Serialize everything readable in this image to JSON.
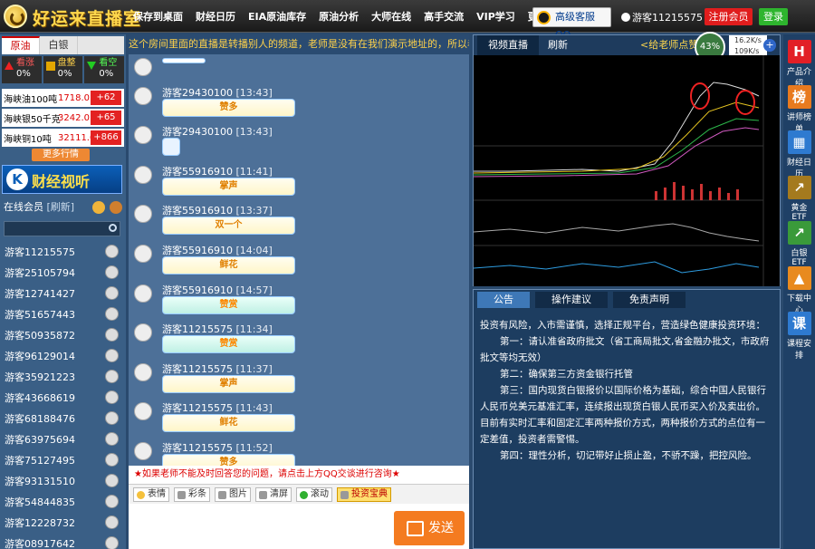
{
  "header": {
    "brand": "好运来直播室",
    "nav": [
      "保存到桌面",
      "财经日历",
      "EIA原油库存",
      "原油分析",
      "大师在线",
      "高手交流",
      "VIP学习",
      "更多"
    ],
    "qq_service": "高级客服QQ",
    "username": "游客11215575",
    "register": "注册会员",
    "login": "登录"
  },
  "left": {
    "tabs": [
      "原油",
      "白银"
    ],
    "stats": [
      {
        "label": "看涨",
        "value": "0%"
      },
      {
        "label": "盘整",
        "value": "0%"
      },
      {
        "label": "看空",
        "value": "0%"
      }
    ],
    "quotes": [
      {
        "name": "海峡油100吨",
        "price": "1718.0",
        "change": "+62"
      },
      {
        "name": "海峡银50千克",
        "price": "3242.0",
        "change": "+65"
      },
      {
        "name": "海峡铜10吨",
        "price": "32111.0",
        "change": "+866"
      }
    ],
    "more_quotes": "更多行情",
    "banner": "财经视听",
    "banner_k": "K",
    "online_title": "在线会员",
    "refresh": "[刷新]",
    "members": [
      "游客11215575",
      "游客25105794",
      "游客12741427",
      "游客51657443",
      "游客50935872",
      "游客96129014",
      "游客35921223",
      "游客43668619",
      "游客68188476",
      "游客63975694",
      "游客75127495",
      "游客93131510",
      "游客54844835",
      "游客12228732",
      "游客08917642"
    ]
  },
  "chat": {
    "marquee": "这个房间里面的直播是转播别人的频道，老师是没有在我们演示地址的，所以老师是看",
    "messages": [
      {
        "user": "",
        "time": "",
        "content": "",
        "type": "text"
      },
      {
        "user": "游客29430100",
        "time": "[13:43]",
        "content": "赞多",
        "type": "gif1"
      },
      {
        "user": "游客29430100",
        "time": "[13:43]",
        "content": "",
        "type": "icon"
      },
      {
        "user": "游客55916910",
        "time": "[11:41]",
        "content": "掌声",
        "type": "gif1"
      },
      {
        "user": "游客55916910",
        "time": "[13:37]",
        "content": "双一个",
        "type": "gif1"
      },
      {
        "user": "游客55916910",
        "time": "[14:04]",
        "content": "鲜花",
        "type": "gif1"
      },
      {
        "user": "游客55916910",
        "time": "[14:57]",
        "content": "赞赏",
        "type": "gif2"
      },
      {
        "user": "游客11215575",
        "time": "[11:34]",
        "content": "赞赏",
        "type": "gif2"
      },
      {
        "user": "游客11215575",
        "time": "[11:37]",
        "content": "掌声",
        "type": "gif1"
      },
      {
        "user": "游客11215575",
        "time": "[11:43]",
        "content": "鲜花",
        "type": "gif1"
      },
      {
        "user": "游客11215575",
        "time": "[11:52]",
        "content": "赞多",
        "type": "gif1"
      }
    ],
    "tip": "★如果老师不能及时回答您的问题，请点击上方QQ交谈进行咨询★",
    "tools": [
      "表情",
      "彩条",
      "图片",
      "清屏",
      "滚动",
      "投资宝典"
    ],
    "send": "发送"
  },
  "video": {
    "tabs": [
      "视频直播",
      "刷新"
    ],
    "gold_link": "<给老师点赞>",
    "buffer": "43%",
    "net_up": "16.2K/s",
    "net_down": "109K/s",
    "plus": "+"
  },
  "notice": {
    "tabs": [
      "公告",
      "操作建议",
      "免责声明"
    ],
    "intro": "投资有风险，入市需谨慎，选择正规平台，营造绿色健康投资环境：",
    "items": [
      "第一：请认准省政府批文（省工商局批文,省金融办批文，市政府批文等均无效）",
      "第二：确保第三方资金银行托管",
      "第三：国内现货白银报价以国际价格为基础，综合中国人民银行人民币兑美元基准汇率，连续报出现货白银人民币买入价及卖出价。目前有实时汇率和固定汇率两种报价方式，两种报价方式的点位有一定差值，投资者需警惕。",
      "第四：理性分析，切记带好止损止盈，不骄不躁，把控风险。"
    ]
  },
  "rside": [
    {
      "label": "产品介绍",
      "icon": "H",
      "color": "#e21f26"
    },
    {
      "label": "讲师榜单",
      "icon": "榜",
      "color": "#e87a1f"
    },
    {
      "label": "财经日历",
      "icon": "▦",
      "color": "#2e7ad0"
    },
    {
      "label": "黄金ETF",
      "icon": "↗",
      "color": "#a47a1e"
    },
    {
      "label": "白银ETF",
      "icon": "↗",
      "color": "#3a9a3a"
    },
    {
      "label": "下载中心",
      "icon": "▲",
      "color": "#e88a1f"
    },
    {
      "label": "课程安排",
      "icon": "课",
      "color": "#2e7ad0"
    }
  ]
}
